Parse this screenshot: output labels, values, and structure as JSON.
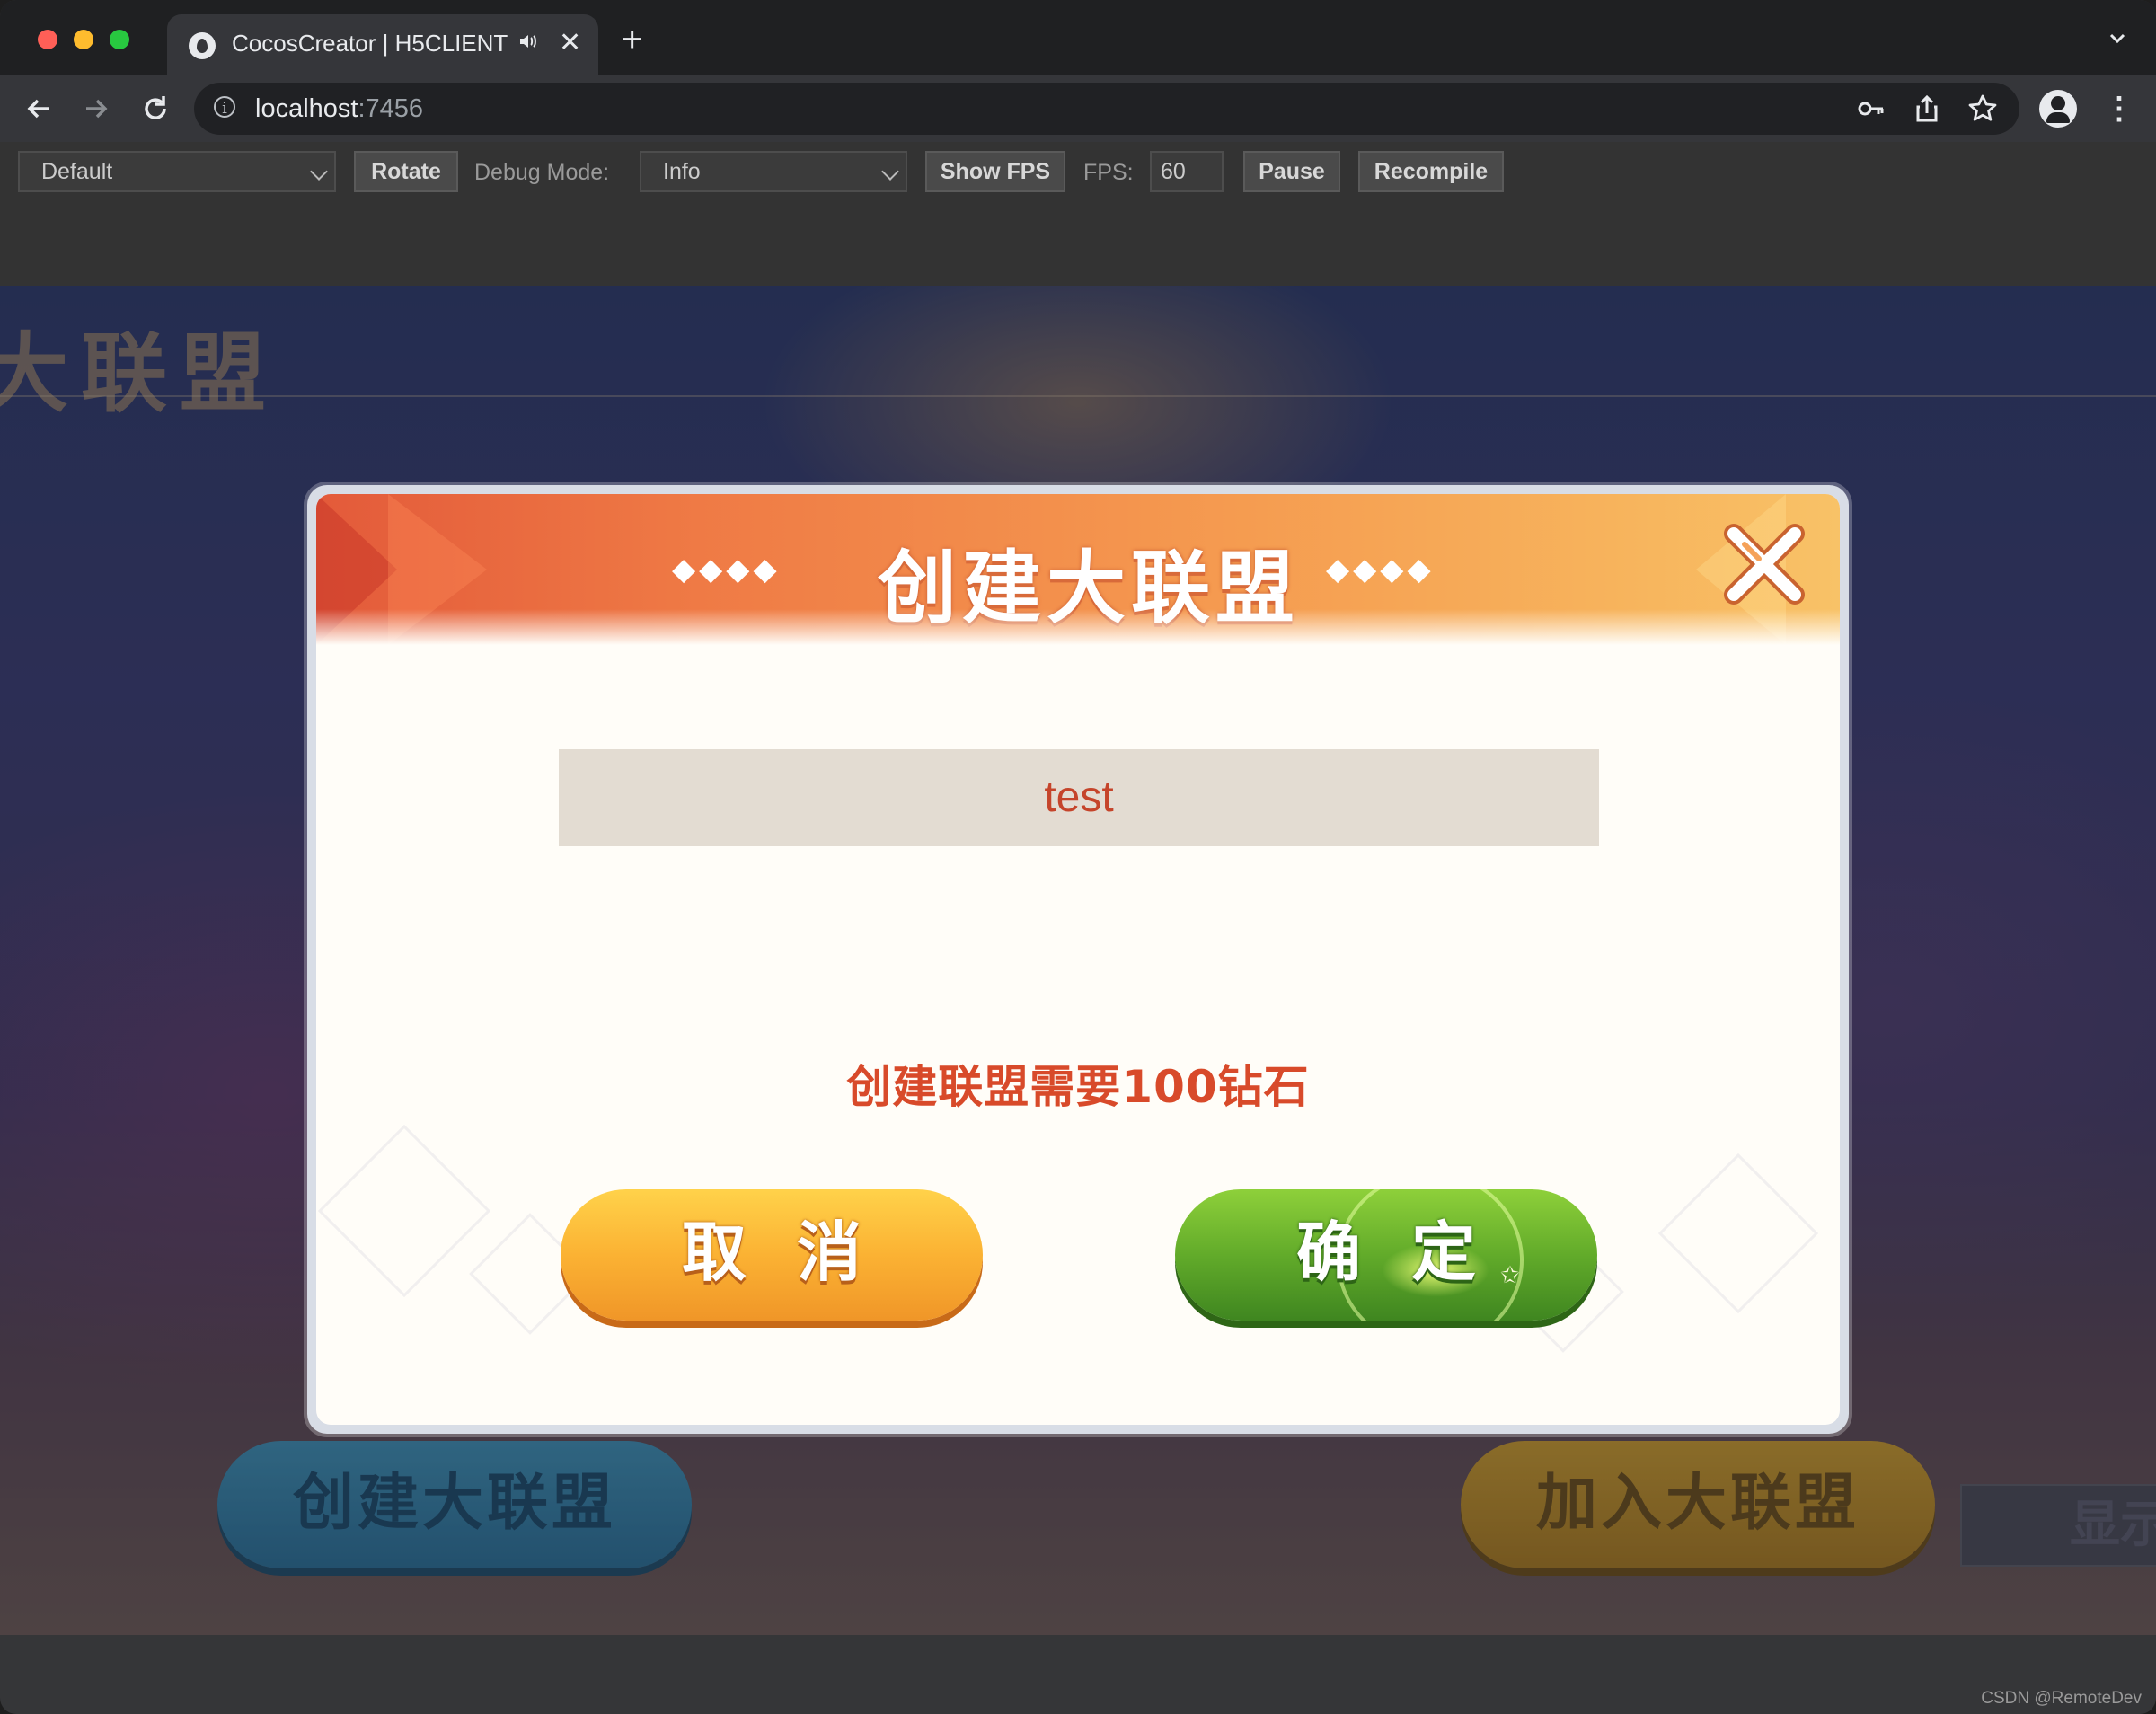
{
  "browser": {
    "tab_title": "CocosCreator | H5CLIENT",
    "tab_close": "✕",
    "new_tab": "+",
    "url_host": "localhost",
    "url_port": ":7456"
  },
  "toolbar": {
    "device_select": "Default",
    "rotate_label": "Rotate",
    "debug_mode_label": "Debug Mode:",
    "debug_mode_value": "Info",
    "show_fps_label": "Show FPS",
    "fps_label": "FPS:",
    "fps_value": "60",
    "pause_label": "Pause",
    "recompile_label": "Recompile"
  },
  "game": {
    "background_title": "大联盟",
    "create_alliance_button": "创建大联盟",
    "join_alliance_button": "加入大联盟",
    "show_button": "显示",
    "dialog": {
      "title": "创建大联盟",
      "left_deco": "◆◆◆◆",
      "right_deco": "◆◆◆◆",
      "name_input_value": "test",
      "cost_text": "创建联盟需要100钻石",
      "cancel_label": "取消",
      "confirm_label": "确定"
    }
  },
  "watermark": "CSDN @RemoteDev",
  "colors": {
    "dialog_header_start": "#e35a3a",
    "dialog_header_end": "#f8c267",
    "cancel_button": "#fbb233",
    "confirm_button": "#62ab2a",
    "cost_text": "#d84a2a"
  },
  "icons": [
    "traffic-lights",
    "cocos-favicon",
    "audio-icon",
    "back-icon",
    "forward-icon",
    "reload-icon",
    "info-icon",
    "key-icon",
    "share-icon",
    "star-icon",
    "profile-icon",
    "menu-icon",
    "close-icon"
  ]
}
